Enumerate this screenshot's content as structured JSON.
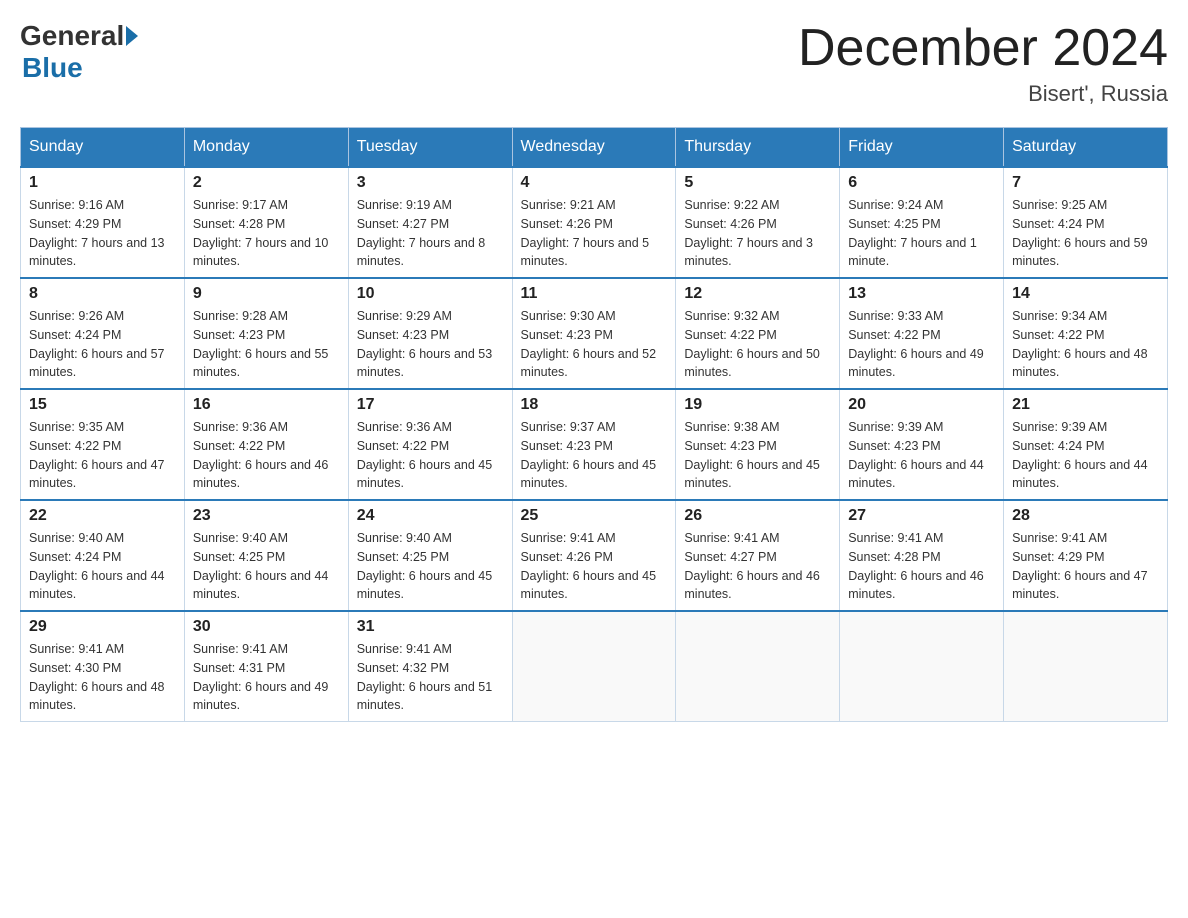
{
  "header": {
    "logo_general": "General",
    "logo_blue": "Blue",
    "month_title": "December 2024",
    "location": "Bisert', Russia"
  },
  "weekdays": [
    "Sunday",
    "Monday",
    "Tuesday",
    "Wednesday",
    "Thursday",
    "Friday",
    "Saturday"
  ],
  "weeks": [
    [
      {
        "day": "1",
        "sunrise": "9:16 AM",
        "sunset": "4:29 PM",
        "daylight": "7 hours and 13 minutes."
      },
      {
        "day": "2",
        "sunrise": "9:17 AM",
        "sunset": "4:28 PM",
        "daylight": "7 hours and 10 minutes."
      },
      {
        "day": "3",
        "sunrise": "9:19 AM",
        "sunset": "4:27 PM",
        "daylight": "7 hours and 8 minutes."
      },
      {
        "day": "4",
        "sunrise": "9:21 AM",
        "sunset": "4:26 PM",
        "daylight": "7 hours and 5 minutes."
      },
      {
        "day": "5",
        "sunrise": "9:22 AM",
        "sunset": "4:26 PM",
        "daylight": "7 hours and 3 minutes."
      },
      {
        "day": "6",
        "sunrise": "9:24 AM",
        "sunset": "4:25 PM",
        "daylight": "7 hours and 1 minute."
      },
      {
        "day": "7",
        "sunrise": "9:25 AM",
        "sunset": "4:24 PM",
        "daylight": "6 hours and 59 minutes."
      }
    ],
    [
      {
        "day": "8",
        "sunrise": "9:26 AM",
        "sunset": "4:24 PM",
        "daylight": "6 hours and 57 minutes."
      },
      {
        "day": "9",
        "sunrise": "9:28 AM",
        "sunset": "4:23 PM",
        "daylight": "6 hours and 55 minutes."
      },
      {
        "day": "10",
        "sunrise": "9:29 AM",
        "sunset": "4:23 PM",
        "daylight": "6 hours and 53 minutes."
      },
      {
        "day": "11",
        "sunrise": "9:30 AM",
        "sunset": "4:23 PM",
        "daylight": "6 hours and 52 minutes."
      },
      {
        "day": "12",
        "sunrise": "9:32 AM",
        "sunset": "4:22 PM",
        "daylight": "6 hours and 50 minutes."
      },
      {
        "day": "13",
        "sunrise": "9:33 AM",
        "sunset": "4:22 PM",
        "daylight": "6 hours and 49 minutes."
      },
      {
        "day": "14",
        "sunrise": "9:34 AM",
        "sunset": "4:22 PM",
        "daylight": "6 hours and 48 minutes."
      }
    ],
    [
      {
        "day": "15",
        "sunrise": "9:35 AM",
        "sunset": "4:22 PM",
        "daylight": "6 hours and 47 minutes."
      },
      {
        "day": "16",
        "sunrise": "9:36 AM",
        "sunset": "4:22 PM",
        "daylight": "6 hours and 46 minutes."
      },
      {
        "day": "17",
        "sunrise": "9:36 AM",
        "sunset": "4:22 PM",
        "daylight": "6 hours and 45 minutes."
      },
      {
        "day": "18",
        "sunrise": "9:37 AM",
        "sunset": "4:23 PM",
        "daylight": "6 hours and 45 minutes."
      },
      {
        "day": "19",
        "sunrise": "9:38 AM",
        "sunset": "4:23 PM",
        "daylight": "6 hours and 45 minutes."
      },
      {
        "day": "20",
        "sunrise": "9:39 AM",
        "sunset": "4:23 PM",
        "daylight": "6 hours and 44 minutes."
      },
      {
        "day": "21",
        "sunrise": "9:39 AM",
        "sunset": "4:24 PM",
        "daylight": "6 hours and 44 minutes."
      }
    ],
    [
      {
        "day": "22",
        "sunrise": "9:40 AM",
        "sunset": "4:24 PM",
        "daylight": "6 hours and 44 minutes."
      },
      {
        "day": "23",
        "sunrise": "9:40 AM",
        "sunset": "4:25 PM",
        "daylight": "6 hours and 44 minutes."
      },
      {
        "day": "24",
        "sunrise": "9:40 AM",
        "sunset": "4:25 PM",
        "daylight": "6 hours and 45 minutes."
      },
      {
        "day": "25",
        "sunrise": "9:41 AM",
        "sunset": "4:26 PM",
        "daylight": "6 hours and 45 minutes."
      },
      {
        "day": "26",
        "sunrise": "9:41 AM",
        "sunset": "4:27 PM",
        "daylight": "6 hours and 46 minutes."
      },
      {
        "day": "27",
        "sunrise": "9:41 AM",
        "sunset": "4:28 PM",
        "daylight": "6 hours and 46 minutes."
      },
      {
        "day": "28",
        "sunrise": "9:41 AM",
        "sunset": "4:29 PM",
        "daylight": "6 hours and 47 minutes."
      }
    ],
    [
      {
        "day": "29",
        "sunrise": "9:41 AM",
        "sunset": "4:30 PM",
        "daylight": "6 hours and 48 minutes."
      },
      {
        "day": "30",
        "sunrise": "9:41 AM",
        "sunset": "4:31 PM",
        "daylight": "6 hours and 49 minutes."
      },
      {
        "day": "31",
        "sunrise": "9:41 AM",
        "sunset": "4:32 PM",
        "daylight": "6 hours and 51 minutes."
      },
      null,
      null,
      null,
      null
    ]
  ],
  "labels": {
    "sunrise_prefix": "Sunrise: ",
    "sunset_prefix": "Sunset: ",
    "daylight_prefix": "Daylight: "
  }
}
